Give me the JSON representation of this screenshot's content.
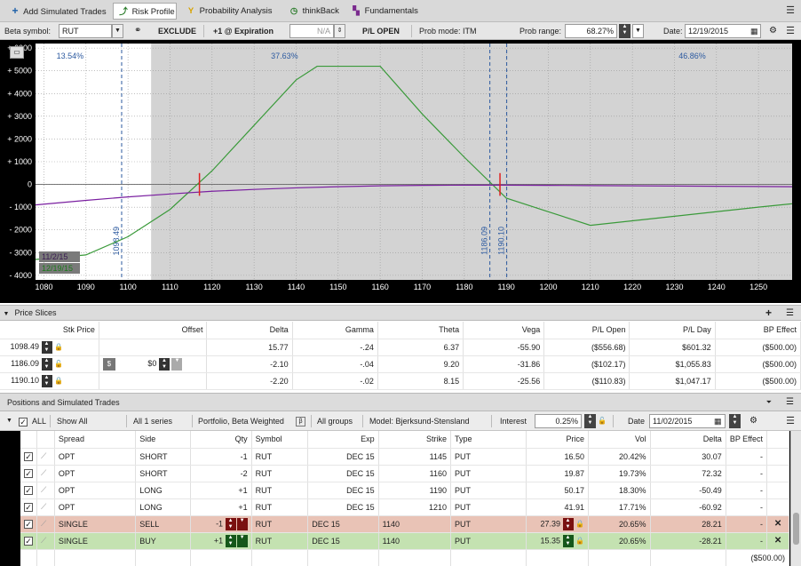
{
  "tabs": [
    {
      "label": "Add Simulated Trades",
      "icon": "plus-icon"
    },
    {
      "label": "Risk Profile",
      "icon": "risk-profile-icon"
    },
    {
      "label": "Probability Analysis",
      "icon": "probability-icon"
    },
    {
      "label": "thinkBack",
      "icon": "clock-icon"
    },
    {
      "label": "Fundamentals",
      "icon": "fundamentals-icon"
    }
  ],
  "controls": {
    "beta_label": "Beta symbol:",
    "beta_value": "RUT",
    "exclude": "EXCLUDE",
    "expiration": "+1 @ Expiration",
    "na": "N/A",
    "pl_open": "P/L OPEN",
    "prob_mode": "Prob mode: ITM",
    "prob_range_label": "Prob range:",
    "prob_range_value": "68.27%",
    "date_label": "Date:",
    "date_value": "12/19/2015"
  },
  "chart_data": {
    "type": "line",
    "xlim": [
      1078,
      1258
    ],
    "ylim": [
      -4200,
      6200
    ],
    "x_ticks": [
      1080,
      1090,
      1100,
      1110,
      1120,
      1130,
      1140,
      1150,
      1160,
      1170,
      1180,
      1190,
      1200,
      1210,
      1220,
      1230,
      1240,
      1250
    ],
    "y_ticks": [
      6000,
      5000,
      4000,
      3000,
      2000,
      1000,
      0,
      -1000,
      -2000,
      -3000,
      -4000
    ],
    "y_tick_labels": [
      "+ 6000",
      "+ 5000",
      "+ 4000",
      "+ 3000",
      "+ 2000",
      "+ 1000",
      "0",
      "- 1000",
      "- 2000",
      "- 3000",
      "- 4000"
    ],
    "prob_labels": [
      "13.54%",
      "37.63%",
      "46.86%"
    ],
    "prob_label_x": [
      1083,
      1134,
      1231
    ],
    "vertical_lines": [
      {
        "x": 1098.49,
        "label": "1098.49"
      },
      {
        "x": 1186.09,
        "label": "1186.09"
      },
      {
        "x": 1190.1,
        "label": "1190.10"
      }
    ],
    "prob_range_x": [
      1098.49,
      1190.1
    ],
    "shaded_start_x": 1105.5,
    "series": [
      {
        "name": "12/19/15",
        "color": "#3a9a3a",
        "x": [
          1078,
          1090,
          1100,
          1110,
          1120,
          1130,
          1140,
          1145,
          1150,
          1160,
          1170,
          1180,
          1190,
          1200,
          1210,
          1220,
          1230,
          1240,
          1250,
          1258
        ],
        "y": [
          -3300,
          -3100,
          -2300,
          -1100,
          600,
          2600,
          4600,
          5200,
          5200,
          5200,
          3100,
          1200,
          -600,
          -1200,
          -1800,
          -1600,
          -1400,
          -1200,
          -1000,
          -850
        ]
      },
      {
        "name": "11/2/15",
        "color": "#7a1fa0",
        "x": [
          1078,
          1090,
          1100,
          1110,
          1120,
          1130,
          1140,
          1150,
          1160,
          1170,
          1180,
          1190,
          1200,
          1210,
          1220,
          1230,
          1240,
          1250,
          1258
        ],
        "y": [
          -900,
          -700,
          -550,
          -420,
          -300,
          -220,
          -150,
          -100,
          -60,
          -40,
          -30,
          -30,
          -40,
          -50,
          -60,
          -70,
          -80,
          -90,
          -100
        ]
      }
    ],
    "markers": [
      1117,
      1188.5
    ]
  },
  "price_slices": {
    "title": "Price Slices",
    "headers": [
      "Stk Price",
      "Offset",
      "Delta",
      "Gamma",
      "Theta",
      "Vega",
      "P/L Open",
      "P/L Day",
      "BP Effect"
    ],
    "rows": [
      {
        "stk": "1098.49",
        "offset": "",
        "delta": "15.77",
        "gamma": "-.24",
        "theta": "6.37",
        "vega": "-55.90",
        "pl_open": "($556.68)",
        "pl_day": "$601.32",
        "bp": "($500.00)"
      },
      {
        "stk": "1186.09",
        "offset": "$0",
        "delta": "-2.10",
        "gamma": "-.04",
        "theta": "9.20",
        "vega": "-31.86",
        "pl_open": "($102.17)",
        "pl_day": "$1,055.83",
        "bp": "($500.00)"
      },
      {
        "stk": "1190.10",
        "offset": "",
        "delta": "-2.20",
        "gamma": "-.02",
        "theta": "8.15",
        "vega": "-25.56",
        "pl_open": "($110.83)",
        "pl_day": "$1,047.17",
        "bp": "($500.00)"
      }
    ],
    "offset_currency": "$"
  },
  "positions": {
    "title": "Positions and Simulated Trades",
    "filters": {
      "all": "ALL",
      "show_all": "Show All",
      "series": "All 1 series",
      "weighting": "Portfolio, Beta Weighted",
      "groups": "All groups",
      "model": "Model: Bjerksund-Stensland",
      "interest_label": "Interest",
      "interest_value": "0.25%",
      "date_label": "Date",
      "date_value": "11/02/2015"
    },
    "headers": [
      "Spread",
      "Side",
      "Qty",
      "Symbol",
      "Exp",
      "Strike",
      "Type",
      "Price",
      "Vol",
      "Delta",
      "BP Effect"
    ],
    "rows": [
      {
        "spread": "OPT",
        "side": "SHORT",
        "qty": "-1",
        "symbol": "RUT",
        "exp": "DEC 15",
        "strike": "1145",
        "type": "PUT",
        "price": "16.50",
        "vol": "20.42%",
        "delta": "30.07",
        "bp": "-",
        "kind": "pos"
      },
      {
        "spread": "OPT",
        "side": "SHORT",
        "qty": "-2",
        "symbol": "RUT",
        "exp": "DEC 15",
        "strike": "1160",
        "type": "PUT",
        "price": "19.87",
        "vol": "19.73%",
        "delta": "72.32",
        "bp": "-",
        "kind": "pos"
      },
      {
        "spread": "OPT",
        "side": "LONG",
        "qty": "+1",
        "symbol": "RUT",
        "exp": "DEC 15",
        "strike": "1190",
        "type": "PUT",
        "price": "50.17",
        "vol": "18.30%",
        "delta": "-50.49",
        "bp": "-",
        "kind": "pos"
      },
      {
        "spread": "OPT",
        "side": "LONG",
        "qty": "+1",
        "symbol": "RUT",
        "exp": "DEC 15",
        "strike": "1210",
        "type": "PUT",
        "price": "41.91",
        "vol": "17.71%",
        "delta": "-60.92",
        "bp": "-",
        "kind": "pos"
      },
      {
        "spread": "SINGLE",
        "side": "SELL",
        "qty": "-1",
        "symbol": "RUT",
        "exp": "DEC 15",
        "strike": "1140",
        "type": "PUT",
        "price": "27.39",
        "vol": "20.65%",
        "delta": "28.21",
        "bp": "-",
        "kind": "sell"
      },
      {
        "spread": "SINGLE",
        "side": "BUY",
        "qty": "+1",
        "symbol": "RUT",
        "exp": "DEC 15",
        "strike": "1140",
        "type": "PUT",
        "price": "15.35",
        "vol": "20.65%",
        "delta": "-28.21",
        "bp": "-",
        "kind": "buy"
      }
    ],
    "total_bp": "($500.00)"
  }
}
